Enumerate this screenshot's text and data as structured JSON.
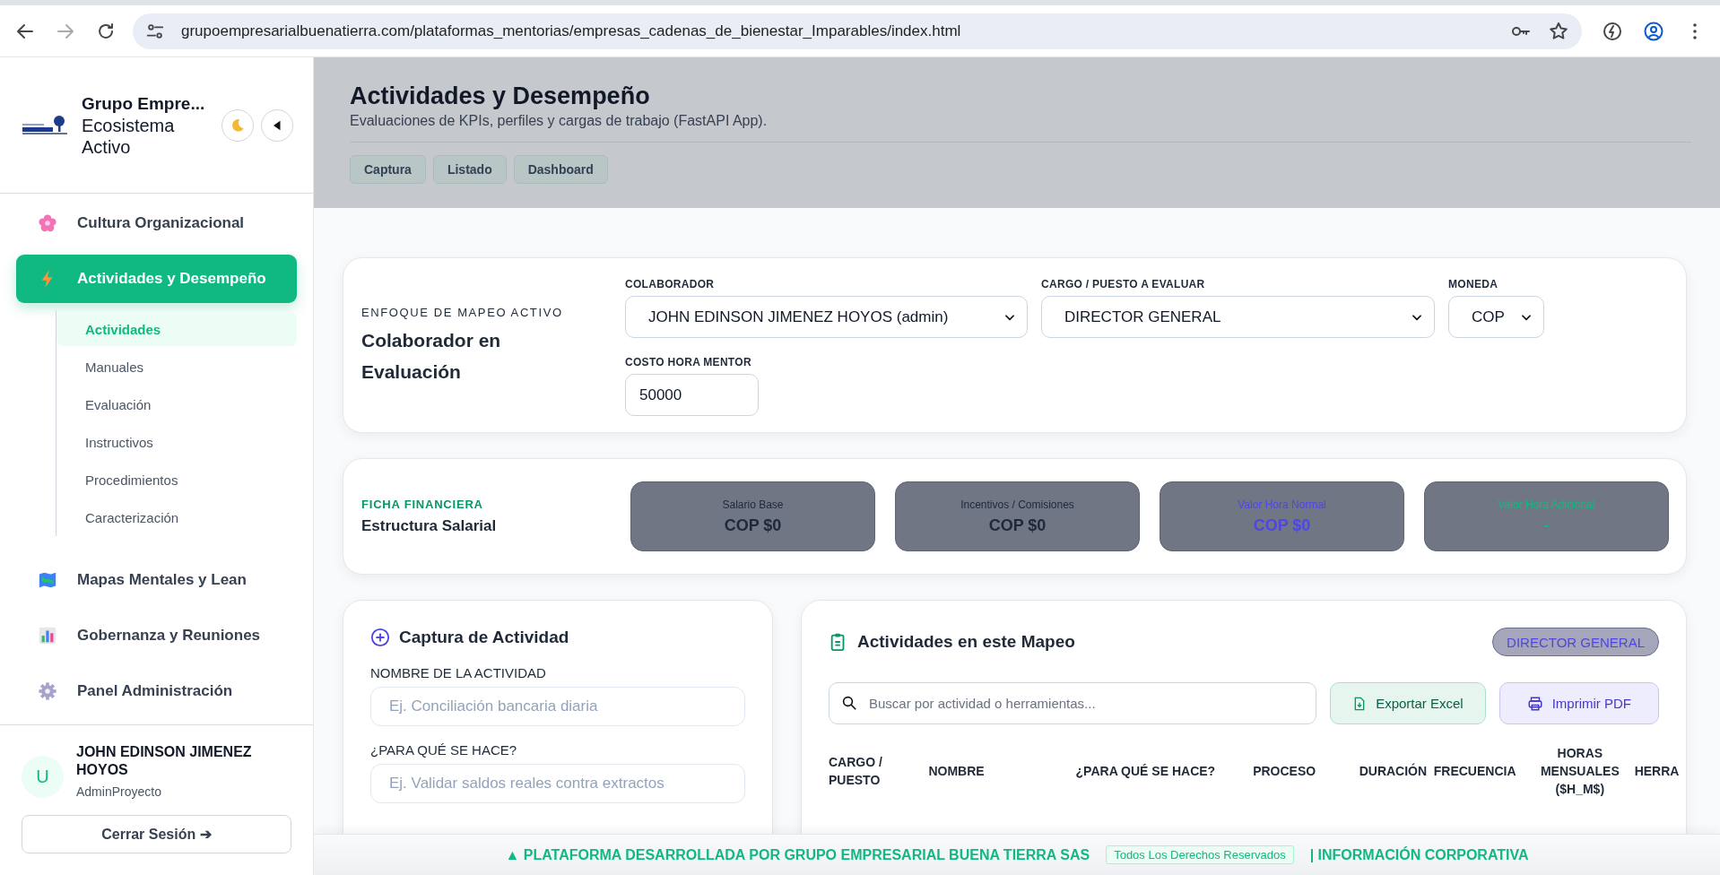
{
  "browser": {
    "url": "grupoempresarialbuenatierra.com/plataformas_mentorias/empresas_cadenas_de_bienestar_Imparables/index.html"
  },
  "sidebar": {
    "brand_title": "Grupo Empre...",
    "brand_subtitle": "Ecosistema Activo",
    "nav": [
      {
        "label": "Cultura Organizacional",
        "selected": false
      },
      {
        "label": "Actividades y Desempeño",
        "selected": true,
        "expanded": true,
        "children": [
          {
            "label": "Actividades",
            "selected": true
          },
          {
            "label": "Manuales",
            "selected": false
          },
          {
            "label": "Evaluación",
            "selected": false
          },
          {
            "label": "Instructivos",
            "selected": false
          },
          {
            "label": "Procedimientos",
            "selected": false
          },
          {
            "label": "Caracterización",
            "selected": false
          }
        ]
      },
      {
        "label": "Mapas Mentales y Lean",
        "selected": false
      },
      {
        "label": "Gobernanza y Reuniones",
        "selected": false
      },
      {
        "label": "Panel Administración",
        "selected": false
      }
    ],
    "user": {
      "initial": "U",
      "name": "JOHN EDINSON JIMENEZ HOYOS",
      "role": "AdminProyecto"
    },
    "logout": "Cerrar Sesión ➔"
  },
  "header": {
    "title": "Actividades y Desempeño",
    "subtitle": "Evaluaciones de KPIs, perfiles y cargas de trabajo (FastAPI App).",
    "tabs": [
      {
        "label": "Captura",
        "selected": false
      },
      {
        "label": "Listado",
        "selected": false
      },
      {
        "label": "Dashboard",
        "selected": false
      }
    ]
  },
  "mapping": {
    "eyebrow": "ENFOQUE DE MAPEO ACTIVO",
    "title": "Colaborador en Evaluación",
    "fields": [
      {
        "label": "COLABORADOR",
        "value": "JOHN EDINSON JIMENEZ HOYOS (admin)",
        "kind": "select"
      },
      {
        "label": "CARGO / PUESTO A EVALUAR",
        "value": "DIRECTOR GENERAL",
        "kind": "select"
      },
      {
        "label": "MONEDA",
        "value": "COP",
        "kind": "select"
      },
      {
        "label": "COSTO HORA MENTOR",
        "value": "50000",
        "kind": "input"
      }
    ]
  },
  "finance": {
    "eyebrow": "FICHA FINANCIERA",
    "title": "Estructura Salarial",
    "stats": [
      {
        "label": "Salario Base",
        "value": "COP $0",
        "color": "#1e293b"
      },
      {
        "label": "Incentivos / Comisiones",
        "value": "COP $0",
        "color": "#1e293b"
      },
      {
        "label": "Valor Hora Normal",
        "value": "COP $0",
        "color": "#4f46e5"
      },
      {
        "label": "Valor Hora Adicional",
        "value": "-",
        "color": "#10b981"
      }
    ]
  },
  "capture": {
    "title": "Captura de Actividad",
    "fields": [
      {
        "label": "NOMBRE DE LA ACTIVIDAD",
        "placeholder": "Ej. Conciliación bancaria diaria"
      },
      {
        "label": "¿PARA QUÉ SE HACE?",
        "placeholder": "Ej. Validar saldos reales contra extractos"
      }
    ]
  },
  "activities": {
    "title": "Actividades en este Mapeo",
    "badge": "DIRECTOR GENERAL",
    "search": {
      "placeholder": "Buscar por actividad o herramientas..."
    },
    "buttons": [
      {
        "label": "Exportar Excel",
        "kind": "excel"
      },
      {
        "label": "Imprimir PDF",
        "kind": "pdf"
      }
    ],
    "table": {
      "columns": [
        "CARGO / PUESTO",
        "NOMBRE",
        "¿PARA QUÉ SE HACE?",
        "PROCESO",
        "DURACIÓN",
        "FRECUENCIA",
        "HORAS MENSUALES ($H_M$)",
        "HERRA"
      ]
    }
  },
  "footer": {
    "text": "▲ PLATAFORMA DESARROLLADA POR GRUPO EMPRESARIAL BUENA TIERRA SAS",
    "badge": "Todos Los Derechos Reservados",
    "link": "| INFORMACIÓN CORPORATIVA"
  }
}
